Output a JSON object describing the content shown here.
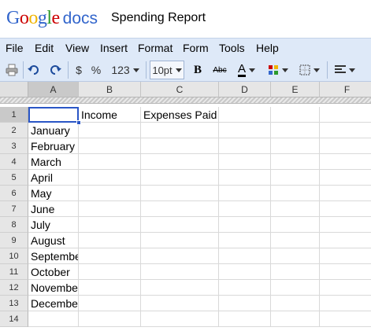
{
  "header": {
    "logo_google": "Google",
    "logo_docs": "docs",
    "title": "Spending Report"
  },
  "colors": {
    "brand_blue": "#3366cc",
    "menubar_bg": "#dee9f8",
    "selection": "#2a56c6"
  },
  "menu": [
    "File",
    "Edit",
    "View",
    "Insert",
    "Format",
    "Form",
    "Tools",
    "Help"
  ],
  "toolbar": {
    "print_icon": "print-icon",
    "undo_icon": "undo-icon",
    "redo_icon": "redo-icon",
    "currency_label": "$",
    "percent_label": "%",
    "number_format_label": "123",
    "font_size": "10pt",
    "bold_label": "B",
    "strike_label": "Abc",
    "text_color_label": "A",
    "bg_color_icon": "fill-color-icon",
    "borders_icon": "borders-icon",
    "align_icon": "align-left-icon"
  },
  "grid": {
    "columns": [
      "A",
      "B",
      "C",
      "D",
      "E",
      "F"
    ],
    "rows": [
      "1",
      "2",
      "3",
      "4",
      "5",
      "6",
      "7",
      "8",
      "9",
      "10",
      "11",
      "12",
      "13",
      "14"
    ],
    "cells": [
      [
        "",
        "Income",
        "Expenses Paid",
        "",
        "",
        ""
      ],
      [
        "January",
        "",
        "",
        "",
        "",
        ""
      ],
      [
        "February",
        "",
        "",
        "",
        "",
        ""
      ],
      [
        "March",
        "",
        "",
        "",
        "",
        ""
      ],
      [
        "April",
        "",
        "",
        "",
        "",
        ""
      ],
      [
        "May",
        "",
        "",
        "",
        "",
        ""
      ],
      [
        "June",
        "",
        "",
        "",
        "",
        ""
      ],
      [
        "July",
        "",
        "",
        "",
        "",
        ""
      ],
      [
        "August",
        "",
        "",
        "",
        "",
        ""
      ],
      [
        "September",
        "",
        "",
        "",
        "",
        ""
      ],
      [
        "October",
        "",
        "",
        "",
        "",
        ""
      ],
      [
        "November",
        "",
        "",
        "",
        "",
        ""
      ],
      [
        "December",
        "",
        "",
        "",
        "",
        ""
      ],
      [
        "",
        "",
        "",
        "",
        "",
        ""
      ]
    ],
    "active_cell": "A1"
  }
}
